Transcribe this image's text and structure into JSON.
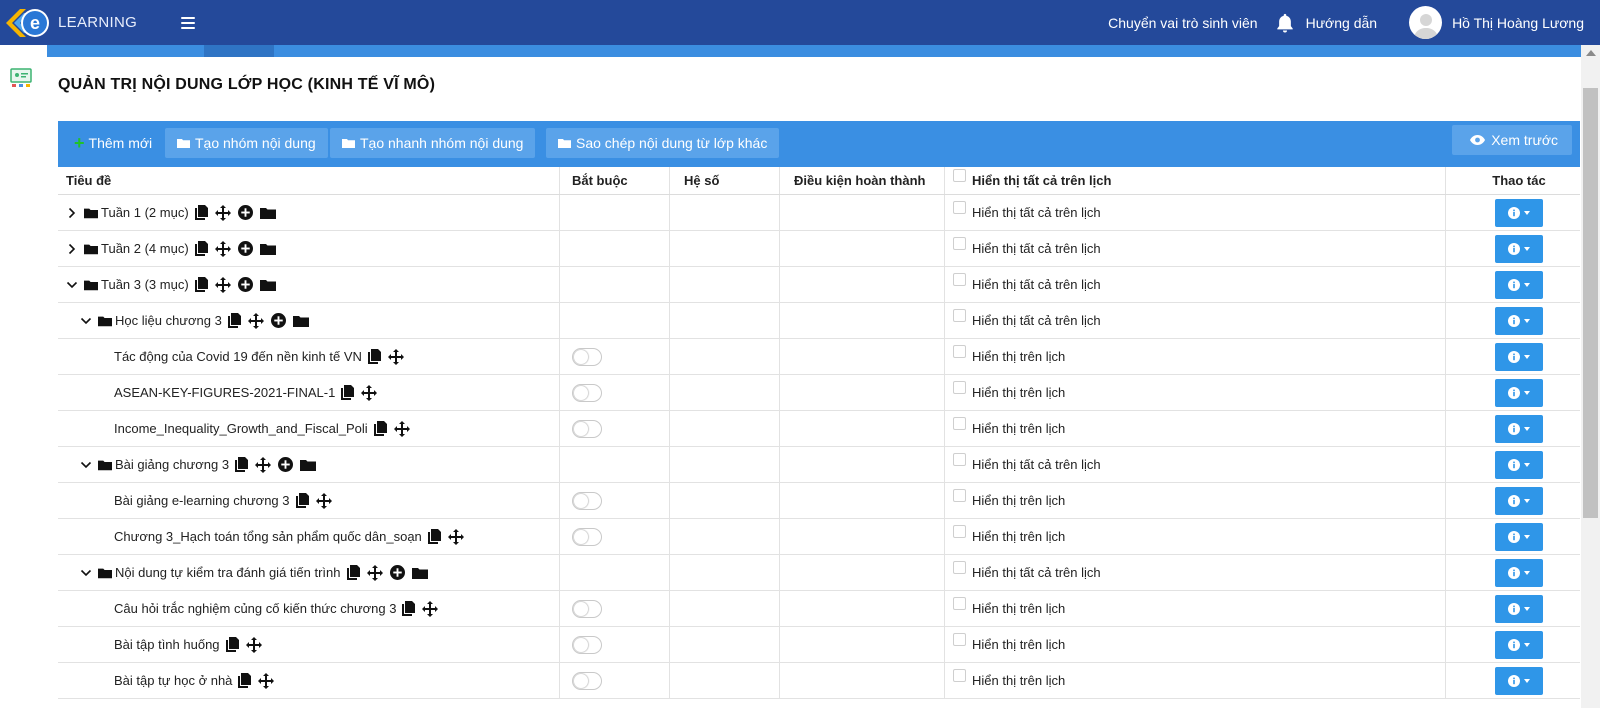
{
  "header": {
    "logo_text": "LEARNING",
    "logo_letter": "e",
    "switch_role": "Chuyển vai trò sinh viên",
    "guide": "Hướng dẫn",
    "user_name": "Hồ Thị Hoàng Lương"
  },
  "page": {
    "title": "QUẢN TRỊ NỘI DUNG LỚP HỌC (KINH TẾ VĨ MÔ)"
  },
  "toolbar": {
    "add_new": "Thêm mới",
    "create_group": "Tạo nhóm nội dung",
    "quick_create_group": "Tạo nhanh nhóm nội dung",
    "copy_from_class": "Sao chép nội dung từ lớp khác",
    "preview": "Xem trước"
  },
  "table": {
    "headers": {
      "title": "Tiêu đề",
      "required": "Bắt buộc",
      "coefficient": "Hệ số",
      "completion": "Điều kiện hoàn thành",
      "calendar_all": "Hiển thị tất cả trên lịch",
      "actions": "Thao tác"
    },
    "rows": [
      {
        "title": "Tuần 1 (2 mục)",
        "cal": "Hiển thị tất cả trên lịch"
      },
      {
        "title": "Tuần 2 (4 mục)",
        "cal": "Hiển thị tất cả trên lịch"
      },
      {
        "title": "Tuần 3 (3 mục)",
        "cal": "Hiển thị tất cả trên lịch"
      },
      {
        "title": "Học liệu chương 3",
        "cal": "Hiển thị tất cả trên lịch"
      },
      {
        "title": "Tác động của Covid 19 đến nền kinh tế VN",
        "cal": "Hiển thị trên lịch"
      },
      {
        "title": "ASEAN-KEY-FIGURES-2021-FINAL-1",
        "cal": "Hiển thị trên lịch"
      },
      {
        "title": "Income_Inequality_Growth_and_Fiscal_Poli",
        "cal": "Hiển thị trên lịch"
      },
      {
        "title": "Bài giảng chương 3",
        "cal": "Hiển thị tất cả trên lịch"
      },
      {
        "title": "Bài giảng e-learning chương 3",
        "cal": "Hiển thị trên lịch"
      },
      {
        "title": "Chương 3_Hạch toán tổng sản phẩm quốc dân_soạn",
        "cal": "Hiển thị trên lịch"
      },
      {
        "title": "Nội dung tự kiểm tra đánh giá tiến trình",
        "cal": "Hiển thị tất cả trên lịch"
      },
      {
        "title": "Câu hỏi trắc nghiệm củng cố kiến thức chương 3",
        "cal": "Hiển thị trên lịch"
      },
      {
        "title": "Bài tập tình huống",
        "cal": "Hiển thị trên lịch"
      },
      {
        "title": "Bài tập tự học ở nhà",
        "cal": "Hiển thị trên lịch"
      }
    ]
  },
  "colors": {
    "header_bg": "#24499a",
    "toolbar_bg": "#3a8fe3",
    "action_button": "#2f96e8",
    "add_plus": "#1fc22a"
  }
}
